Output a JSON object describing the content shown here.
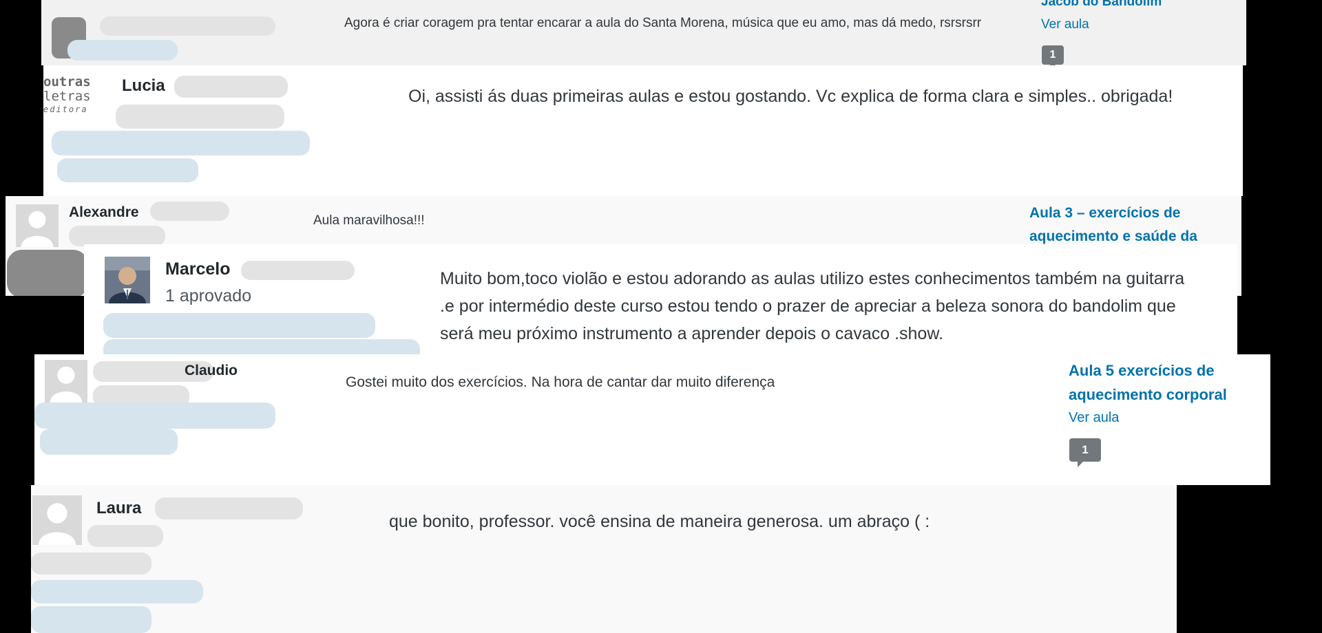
{
  "rows": [
    {
      "comment": "Agora é criar coragem pra tentar encarar a aula do Santa Morena, música que eu amo, mas dá medo, rsrsrsrr",
      "post_link": "Jacob do Bandolim",
      "view_link": "Ver aula",
      "count": "1"
    },
    {
      "author_first": "Lucia",
      "logo_lines": [
        "outras",
        "letras",
        "editora"
      ],
      "comment": "Oi, assisti ás duas primeiras aulas e estou gostando. Vc explica de forma clara e simples.. obrigada!"
    },
    {
      "author_first": "Alexandre",
      "comment": "Aula maravilhosa!!!",
      "post_link": "Aula 3 – exercícios de aquecimento e saúde da"
    },
    {
      "author_first": "Marcelo",
      "status": "1 aprovado",
      "comment": "Muito bom,toco violão e estou adorando as aulas utilizo estes conhecimentos também na guitarra .e por intermédio deste curso estou tendo o prazer de apreciar a beleza sonora do bandolim que será meu próximo instrumento a aprender depois o cavaco .show."
    },
    {
      "author_first": "Claudio",
      "comment": "Gostei muito dos exercícios. Na hora de cantar dar muito diferença",
      "post_link_1": "Aula 5 exercícios de",
      "post_link_2": "aquecimento corporal",
      "view_link": "Ver aula",
      "count": "1"
    },
    {
      "author_first": "Laura",
      "comment": "que bonito, professor. você ensina de maneira generosa. um abraço ( :"
    }
  ],
  "colors": {
    "link": "#0073aa",
    "text": "#32373c",
    "bubble": "#72777c",
    "canvas": "#000000"
  },
  "icons": [
    "avatar-placeholder-icon",
    "comment-count-icon"
  ]
}
